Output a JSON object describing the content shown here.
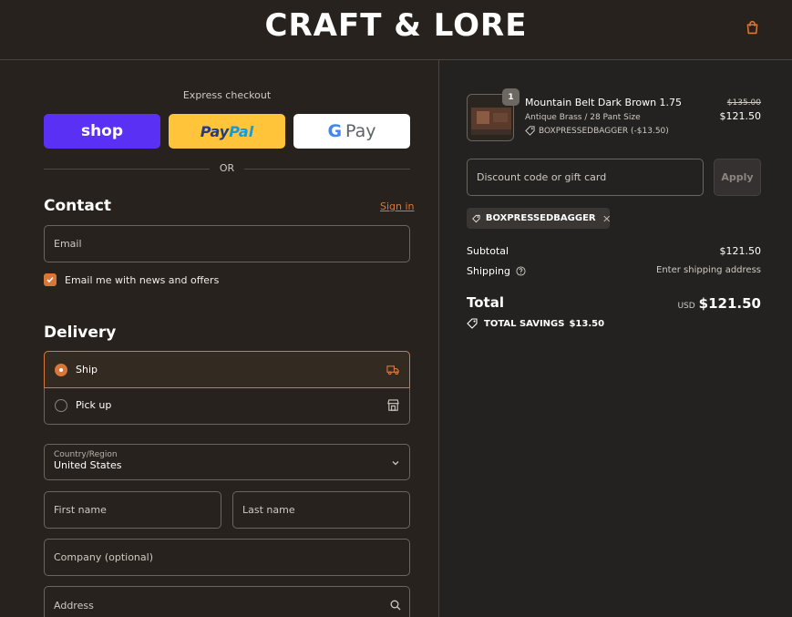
{
  "header": {
    "logo": "CRAFT & LORE"
  },
  "express": {
    "label": "Express checkout",
    "shop_label": "shop",
    "paypal_part1": "Pay",
    "paypal_part2": "Pal",
    "gpay_g": "G",
    "gpay_label": "Pay",
    "or_label": "OR"
  },
  "contact": {
    "title": "Contact",
    "signin": "Sign in",
    "email_placeholder": "Email",
    "newsletter_label": "Email me with news and offers",
    "newsletter_checked": true
  },
  "delivery": {
    "title": "Delivery",
    "options": [
      {
        "label": "Ship",
        "selected": true
      },
      {
        "label": "Pick up",
        "selected": false
      }
    ],
    "country_label": "Country/Region",
    "country_value": "United States",
    "first_name_placeholder": "First name",
    "last_name_placeholder": "Last name",
    "company_placeholder": "Company (optional)",
    "address_placeholder": "Address"
  },
  "order": {
    "product": {
      "name": "Mountain Belt Dark Brown 1.75",
      "variant": "Antique Brass / 28 Pant Size",
      "discount": "BOXPRESSEDBAGGER (-$13.50)",
      "quantity": "1",
      "original_price": "$135.00",
      "price": "$121.50"
    },
    "discount_placeholder": "Discount code or gift card",
    "apply_label": "Apply",
    "applied_code": "BOXPRESSEDBAGGER",
    "subtotal_label": "Subtotal",
    "subtotal_value": "$121.50",
    "shipping_label": "Shipping",
    "shipping_value": "Enter shipping address",
    "total_label": "Total",
    "currency": "USD",
    "total_value": "$121.50",
    "savings_label": "TOTAL SAVINGS",
    "savings_value": "$13.50"
  },
  "colors": {
    "accent": "#d9773a",
    "background": "#27221d",
    "shop": "#5a31f4",
    "paypal": "#ffc439"
  }
}
